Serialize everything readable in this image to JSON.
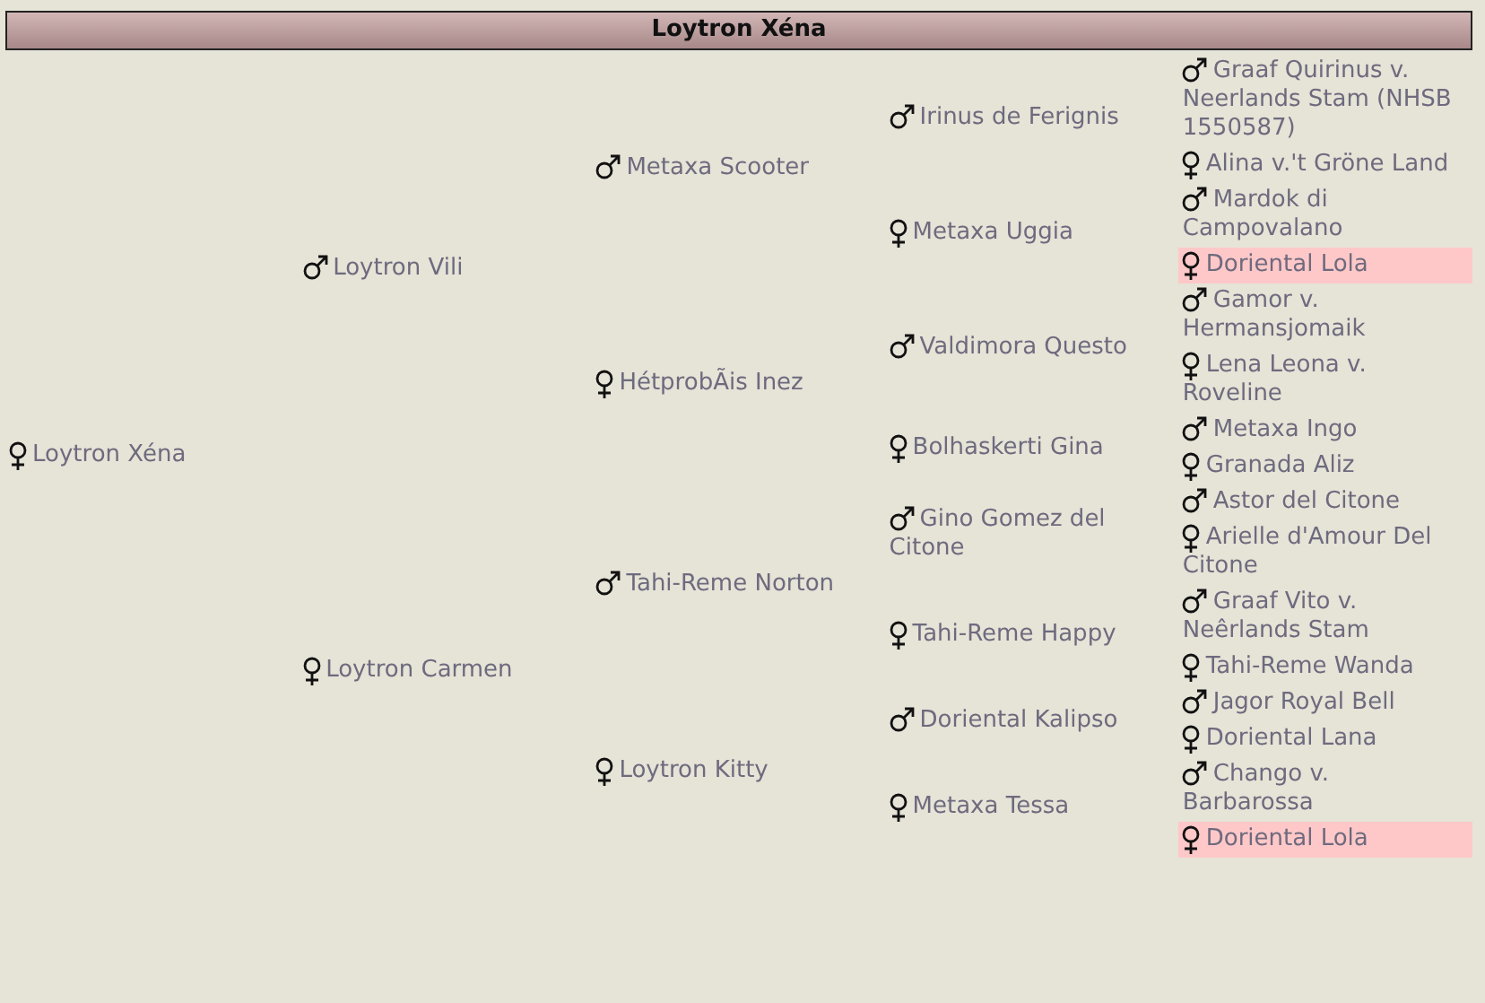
{
  "header": {
    "title": "Loytron Xéna"
  },
  "pedigree": {
    "name": "Loytron Xéna",
    "kind": "female",
    "highlighted": false,
    "parents": [
      {
        "name": "Loytron Vili",
        "kind": "male",
        "highlighted": false,
        "parents": [
          {
            "name": "Metaxa Scooter",
            "kind": "male",
            "highlighted": false,
            "parents": [
              {
                "name": "Irinus de Ferignis",
                "kind": "male",
                "highlighted": false,
                "parents": [
                  {
                    "name": "Graaf Quirinus v. Neerlands Stam (NHSB 1550587)",
                    "kind": "male",
                    "highlighted": false
                  },
                  {
                    "name": "Alina v.'t Gröne Land",
                    "kind": "female",
                    "highlighted": false
                  }
                ]
              },
              {
                "name": "Metaxa Uggia",
                "kind": "female",
                "highlighted": false,
                "parents": [
                  {
                    "name": "Mardok di Campovalano",
                    "kind": "male",
                    "highlighted": false
                  },
                  {
                    "name": "Doriental Lola",
                    "kind": "female",
                    "highlighted": true
                  }
                ]
              }
            ]
          },
          {
            "name": "HétprobÃis Inez",
            "kind": "female",
            "highlighted": false,
            "parents": [
              {
                "name": "Valdimora Questo",
                "kind": "male",
                "highlighted": false,
                "parents": [
                  {
                    "name": "Gamor v. Hermansjomaik",
                    "kind": "male",
                    "highlighted": false
                  },
                  {
                    "name": "Lena Leona v. Roveline",
                    "kind": "female",
                    "highlighted": false
                  }
                ]
              },
              {
                "name": "Bolhaskerti Gina",
                "kind": "female",
                "highlighted": false,
                "parents": [
                  {
                    "name": "Metaxa Ingo",
                    "kind": "male",
                    "highlighted": false
                  },
                  {
                    "name": "Granada Aliz",
                    "kind": "female",
                    "highlighted": false
                  }
                ]
              }
            ]
          }
        ]
      },
      {
        "name": "Loytron Carmen",
        "kind": "female",
        "highlighted": false,
        "parents": [
          {
            "name": "Tahi-Reme Norton",
            "kind": "male",
            "highlighted": false,
            "parents": [
              {
                "name": "Gino Gomez del Citone",
                "kind": "male",
                "highlighted": false,
                "parents": [
                  {
                    "name": "Astor del Citone",
                    "kind": "male",
                    "highlighted": false
                  },
                  {
                    "name": "Arielle d'Amour Del Citone",
                    "kind": "female",
                    "highlighted": false
                  }
                ]
              },
              {
                "name": "Tahi-Reme Happy",
                "kind": "female",
                "highlighted": false,
                "parents": [
                  {
                    "name": "Graaf Vito v. Neêrlands Stam",
                    "kind": "male",
                    "highlighted": false
                  },
                  {
                    "name": "Tahi-Reme Wanda",
                    "kind": "female",
                    "highlighted": false
                  }
                ]
              }
            ]
          },
          {
            "name": "Loytron Kitty",
            "kind": "female",
            "highlighted": false,
            "parents": [
              {
                "name": "Doriental Kalipso",
                "kind": "male",
                "highlighted": false,
                "parents": [
                  {
                    "name": "Jagor Royal Bell",
                    "kind": "male",
                    "highlighted": false
                  },
                  {
                    "name": "Doriental Lana",
                    "kind": "female",
                    "highlighted": false
                  }
                ]
              },
              {
                "name": "Metaxa Tessa",
                "kind": "female",
                "highlighted": false,
                "parents": [
                  {
                    "name": "Chango v. Barbarossa",
                    "kind": "male",
                    "highlighted": false
                  },
                  {
                    "name": "Doriental Lola",
                    "kind": "female",
                    "highlighted": true
                  }
                ]
              }
            ]
          }
        ]
      }
    ]
  }
}
